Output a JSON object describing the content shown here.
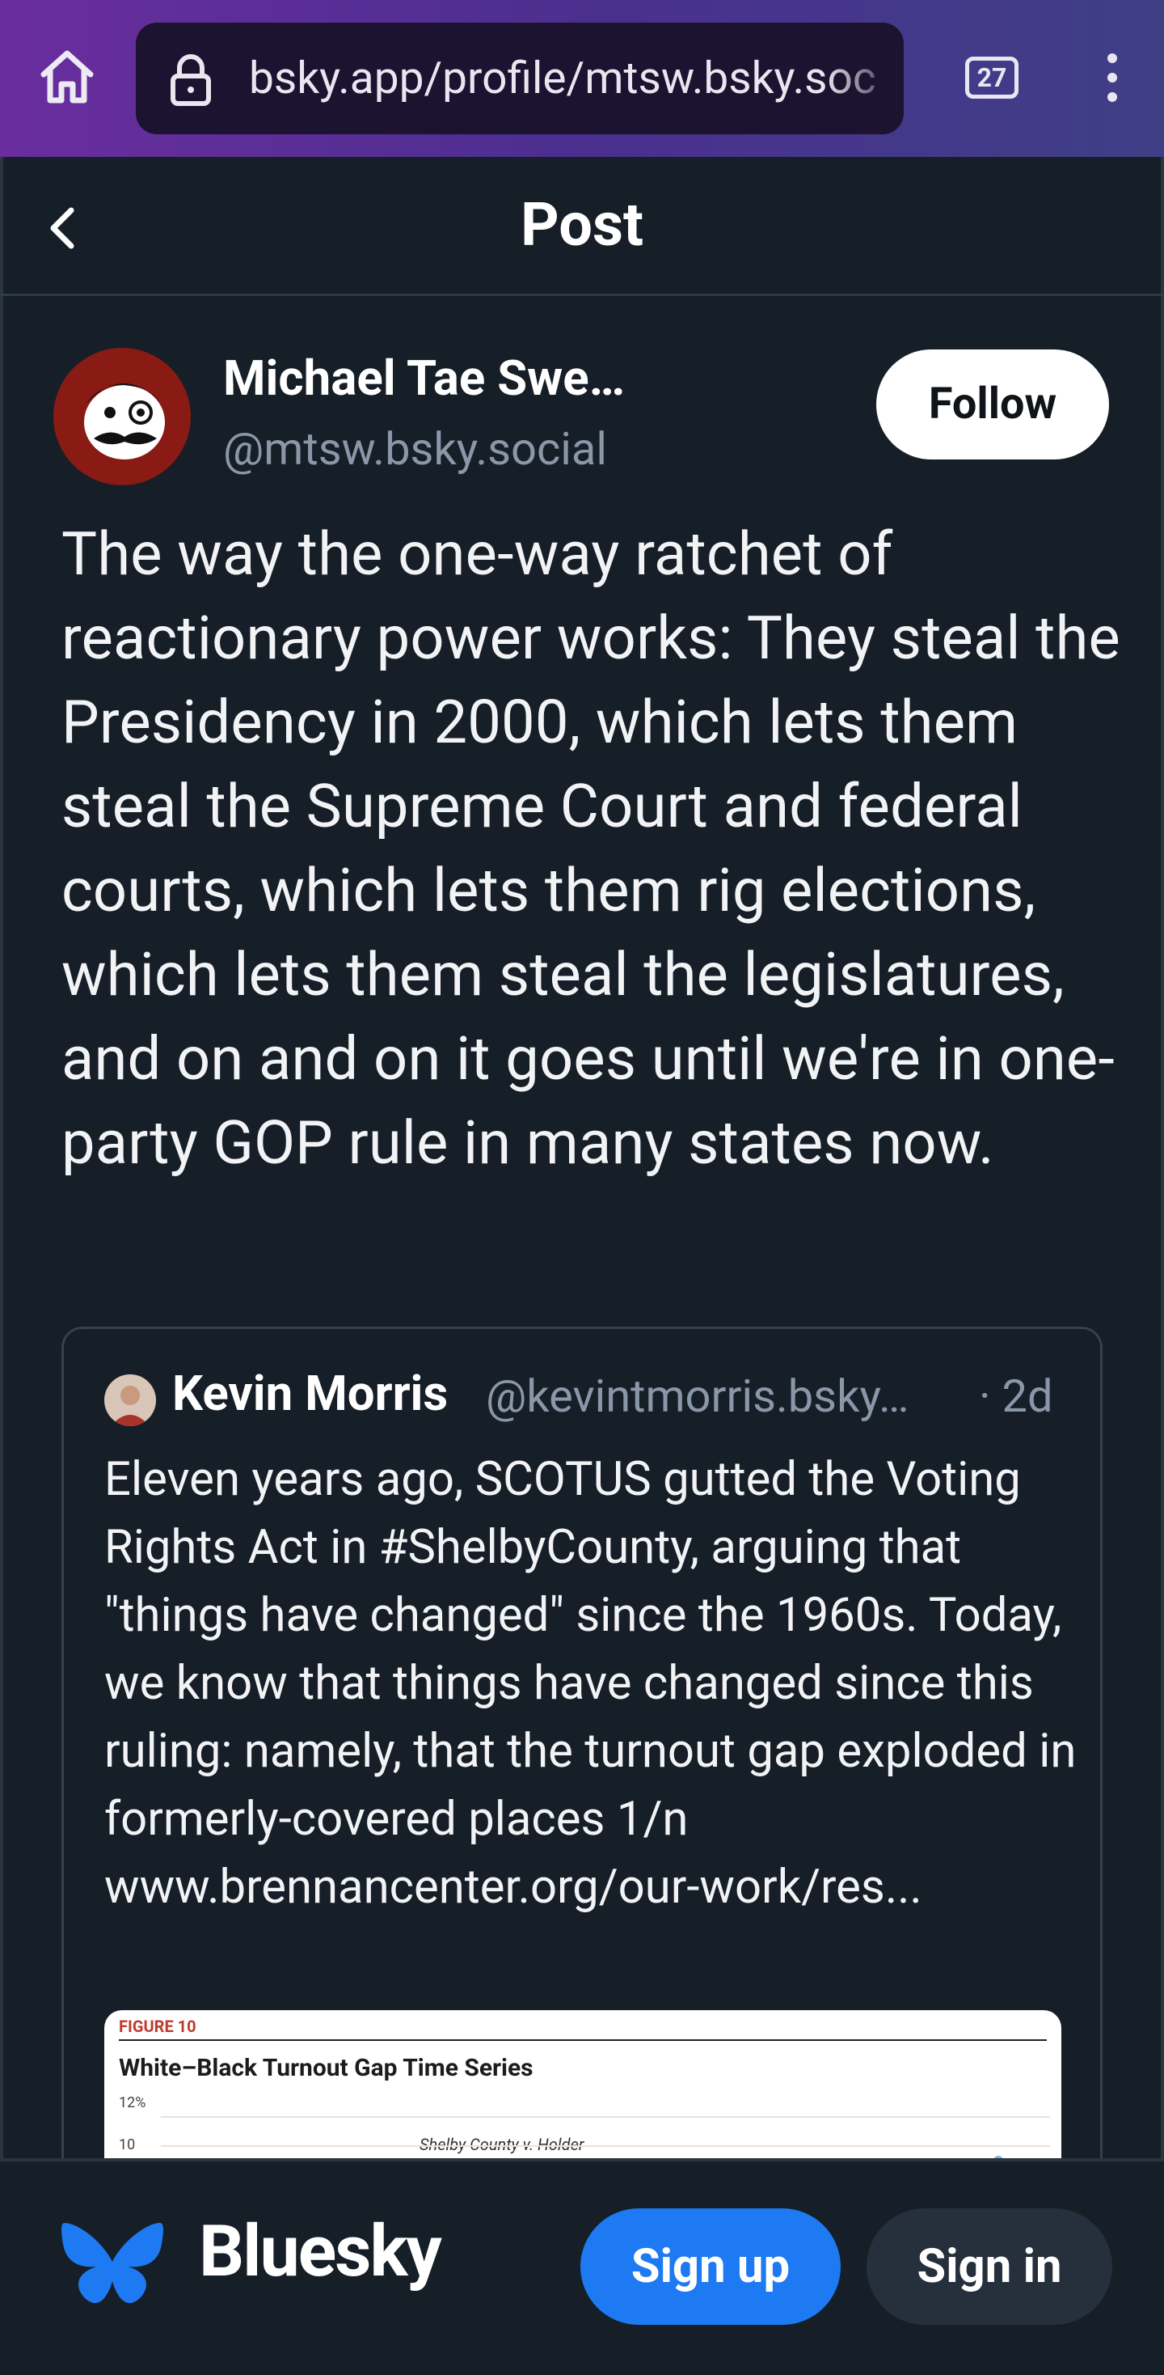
{
  "browser": {
    "url": "bsky.app/profile/mtsw.bsky.soc",
    "tab_count": "27"
  },
  "header": {
    "title": "Post"
  },
  "post": {
    "author_name": "Michael Tae Swe…",
    "author_handle": "@mtsw.bsky.social",
    "follow_label": "Follow",
    "text": "The way the one-way ratchet of reactionary power works: They steal the Presidency in 2000, which lets them steal the Supreme Court and federal courts, which lets them rig elections, which lets them steal the legislatures, and on and on it goes until we're in one-party GOP rule in many states now."
  },
  "quote": {
    "author_name": "Kevin Morris",
    "author_handle": "@kevintmorris.bsky…",
    "time": "· 2d",
    "text": "Eleven years ago, SCOTUS gutted the Voting Rights Act in #ShelbyCounty, arguing that \"things have changed\" since the 1960s. Today, we know that things have changed since this ruling: namely, that the turnout gap exploded in formerly-covered places 1/n www.brennancenter.org/our-work/res...",
    "image": {
      "figure_label": "FIGURE 10",
      "title": "White–Black Turnout Gap Time Series",
      "tick_top": "12%",
      "tick_second": "10",
      "annotation": "Shelby County v. Holder"
    }
  },
  "bottom": {
    "brand": "Bluesky",
    "signup_label": "Sign up",
    "signin_label": "Sign in"
  },
  "colors": {
    "background": "#161e27",
    "accent": "#1d7af2",
    "muted_text": "#8a97a8"
  }
}
